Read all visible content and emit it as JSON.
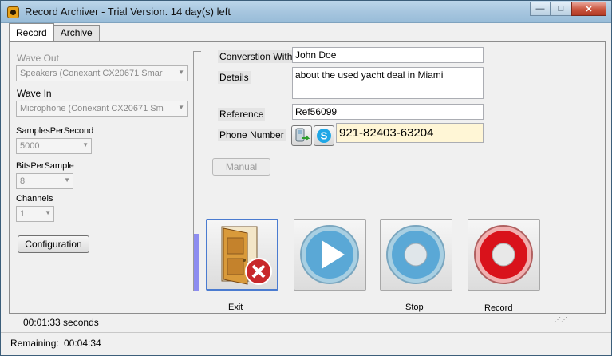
{
  "window": {
    "title": "Record Archiver - Trial Version. 14 day(s) left",
    "minimize_icon": "minimize-icon",
    "maximize_icon": "maximize-icon",
    "close_icon": "close-icon"
  },
  "tabs": [
    {
      "label": "Record",
      "active": true
    },
    {
      "label": "Archive",
      "active": false
    }
  ],
  "left_panel": {
    "wave_out_label": "Wave Out",
    "wave_out_value": "Speakers (Conexant CX20671 Smar",
    "wave_in_label": "Wave In",
    "wave_in_value": "Microphone (Conexant CX20671 Sm",
    "samples_label": "SamplesPerSecond",
    "samples_value": "5000",
    "bits_label": "BitsPerSample",
    "bits_value": "8",
    "channels_label": "Channels",
    "channels_value": "1",
    "configuration_button": "Configuration"
  },
  "form": {
    "conversation_label": "Converstion With",
    "conversation_value": "John Doe",
    "details_label": "Details",
    "details_value": "about the used yacht deal in Miami",
    "reference_label": "Reference",
    "reference_value": "Ref56099",
    "phone_label": "Phone Number",
    "phone_value": "921-82403-63204",
    "manual_button": "Manual",
    "phone_book_icon": "phone-book-icon",
    "skype_icon": "skype-icon"
  },
  "controls": {
    "exit_label": "Exit",
    "play_label": "",
    "stop_label": "Stop",
    "record_label": "Record",
    "colors": {
      "record": "#d9121b",
      "play": "#5aa8d6",
      "exit": "#c8282a"
    }
  },
  "status": {
    "elapsed": "00:01:33 seconds",
    "remaining_label": "Remaining:",
    "remaining_value": "00:04:34"
  }
}
